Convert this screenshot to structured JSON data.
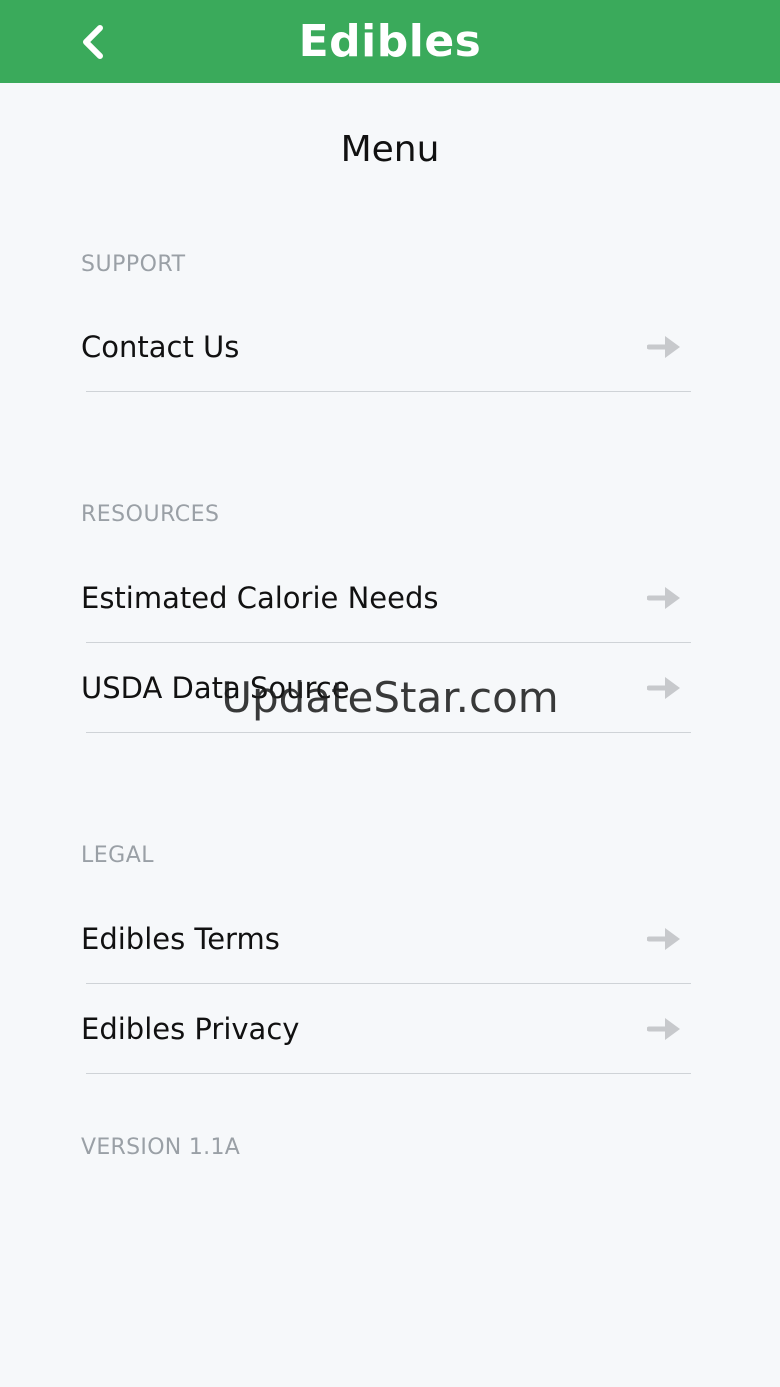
{
  "header": {
    "app_title": "Edibles",
    "background_color": "#3aaa5b",
    "back_icon": "chevron-left-icon"
  },
  "page": {
    "title": "Menu"
  },
  "sections": {
    "support": {
      "header": "SUPPORT",
      "items": [
        {
          "label": "Contact Us",
          "icon": "arrow-right-icon"
        }
      ]
    },
    "resources": {
      "header": "RESOURCES",
      "items": [
        {
          "label": "Estimated Calorie Needs",
          "icon": "arrow-right-icon"
        },
        {
          "label": "USDA Data Source",
          "icon": "arrow-right-icon"
        }
      ]
    },
    "legal": {
      "header": "LEGAL",
      "items": [
        {
          "label": "Edibles Terms",
          "icon": "arrow-right-icon"
        },
        {
          "label": "Edibles Privacy",
          "icon": "arrow-right-icon"
        }
      ]
    }
  },
  "footer": {
    "version": "VERSION 1.1A"
  },
  "watermark": "UpdateStar.com"
}
